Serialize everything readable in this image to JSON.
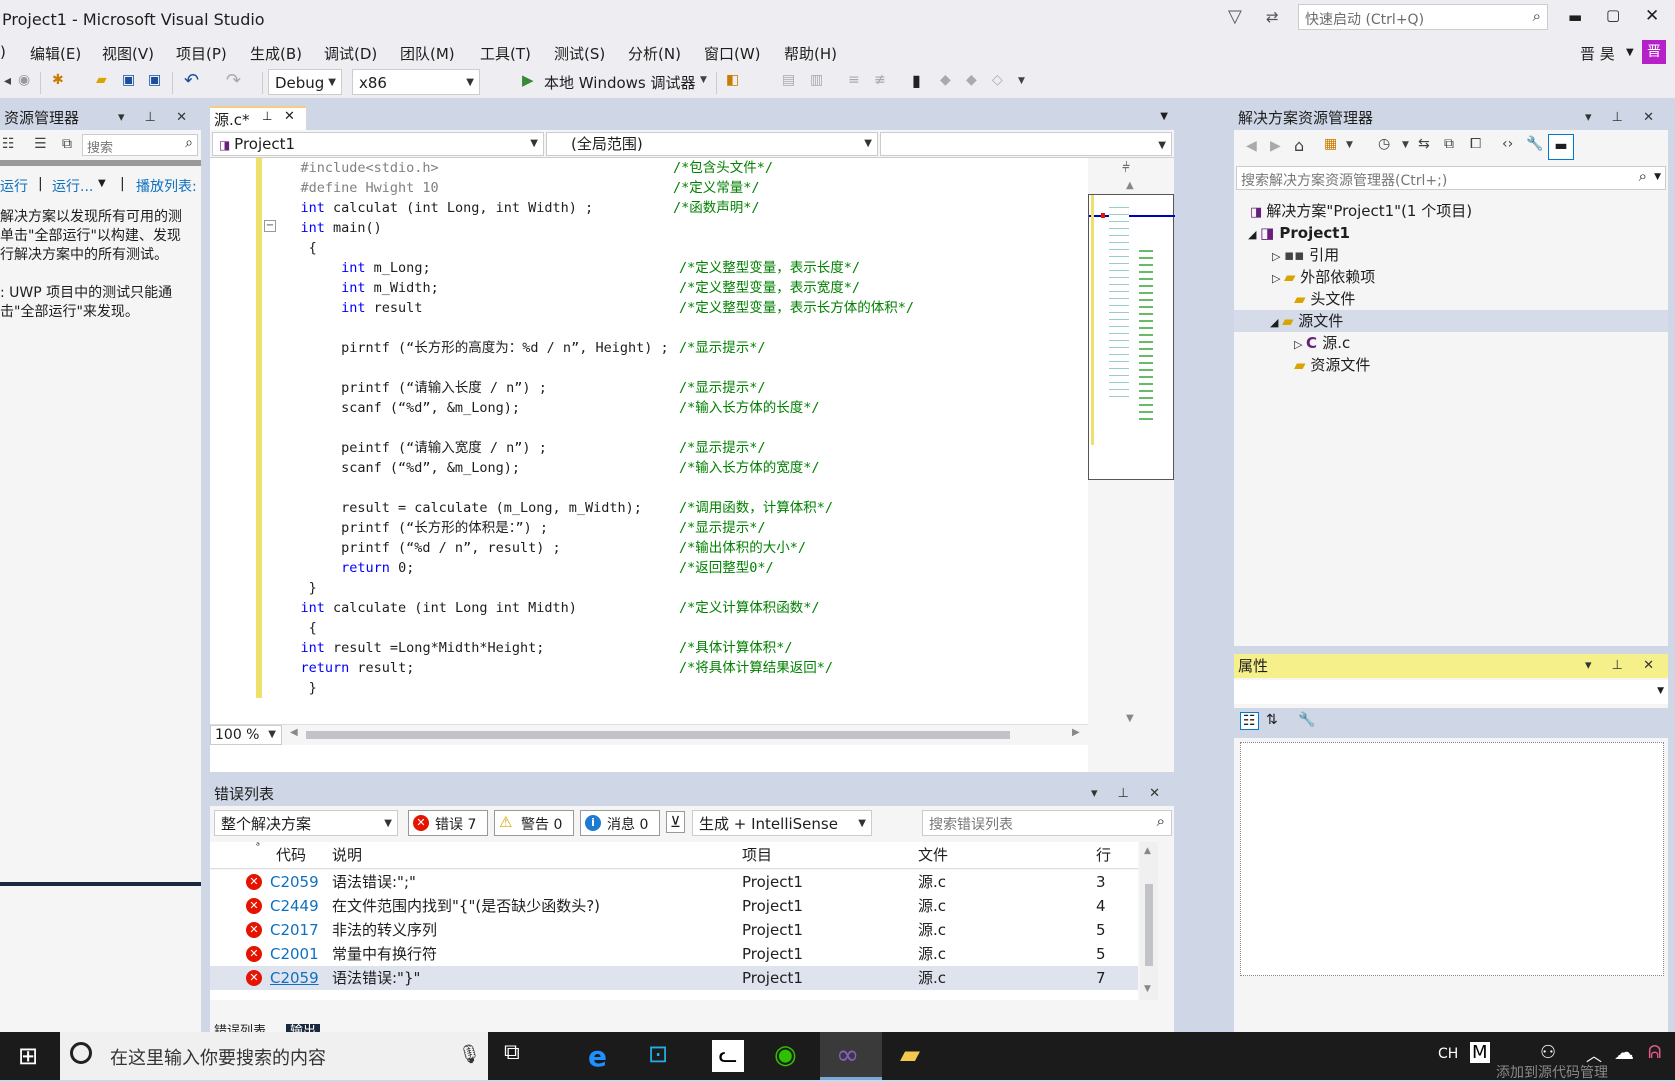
{
  "title": "Project1 - Microsoft Visual Studio",
  "quick_launch": {
    "placeholder": "快速启动 (Ctrl+Q)"
  },
  "user": {
    "name": "晋 昊",
    "initial": "晋"
  },
  "menu": [
    "编辑(E)",
    "视图(V)",
    "项目(P)",
    "生成(B)",
    "调试(D)",
    "团队(M)",
    "工具(T)",
    "测试(S)",
    "分析(N)",
    "窗口(W)",
    "帮助(H)"
  ],
  "toolbar": {
    "config": "Debug",
    "platform": "x86",
    "run_label": "本地 Windows 调试器"
  },
  "test_explorer": {
    "title": "资源管理器",
    "search_placeholder": "搜索",
    "run_label": "运行",
    "run_more_label": "运行...",
    "playlist_label": "播放列表:",
    "info_lines": [
      "解决方案以发现所有可用的测",
      "单击\"全部运行\"以构建、发现",
      "行解决方案中的所有测试。",
      "",
      ": UWP 项目中的测试只能通",
      "击\"全部运行\"来发现。"
    ]
  },
  "editor": {
    "tab_label": "源.c*",
    "nav_project": "Project1",
    "nav_scope": "(全局范围)",
    "zoom": "100 %",
    "lines": [
      {
        "code": "    #include<stdio.h>",
        "comment": "/*包含头文件*/"
      },
      {
        "code": "    #define Hwight 10",
        "comment": "/*定义常量*/"
      },
      {
        "code": "    int calculat (int Long, int Width) ;",
        "comment": "/*函数声明*/"
      },
      {
        "code": "    int main()",
        "comment": ""
      },
      {
        "code": "     {",
        "comment": ""
      },
      {
        "code": "         int m_Long;",
        "comment": "/*定义整型变量，表示长度*/"
      },
      {
        "code": "         int m_Width;",
        "comment": "/*定义整型变量，表示宽度*/"
      },
      {
        "code": "         int result",
        "comment": "/*定义整型变量，表示长方体的体积*/"
      },
      {
        "code": "",
        "comment": ""
      },
      {
        "code": "         pirntf (“长方形的高度为：%d / n”, Height) ;",
        "comment": "/*显示提示*/"
      },
      {
        "code": "",
        "comment": ""
      },
      {
        "code": "         printf (“请输入长度 / n”) ;",
        "comment": "/*显示提示*/"
      },
      {
        "code": "         scanf (“%d”, &m_Long);",
        "comment": "/*输入长方体的长度*/"
      },
      {
        "code": "",
        "comment": ""
      },
      {
        "code": "         peintf (“请输入宽度 / n”) ;",
        "comment": "/*显示提示*/"
      },
      {
        "code": "         scanf (“%d”, &m_Long);",
        "comment": "/*输入长方体的宽度*/"
      },
      {
        "code": "",
        "comment": ""
      },
      {
        "code": "         result = calculate (m_Long, m_Width);",
        "comment": "/*调用函数，计算体积*/"
      },
      {
        "code": "         printf (“长方形的体积是：”) ;",
        "comment": "/*显示提示*/"
      },
      {
        "code": "         printf (“%d / n”, result) ;",
        "comment": "/*输出体积的大小*/"
      },
      {
        "code": "         return 0;",
        "comment": "/*返回整型0*/"
      },
      {
        "code": "     }",
        "comment": ""
      },
      {
        "code": "    int calculate (int Long int Midth)",
        "comment": "/*定义计算体积函数*/"
      },
      {
        "code": "     {",
        "comment": ""
      },
      {
        "code": "    int result =Long*Midth*Height;",
        "comment": "/*具体计算体积*/"
      },
      {
        "code": "    return result;",
        "comment": "/*将具体计算结果返回*/"
      },
      {
        "code": "     }",
        "comment": ""
      }
    ]
  },
  "solution_explorer": {
    "title": "解决方案资源管理器",
    "search_placeholder": "搜索解决方案资源管理器(Ctrl+;)",
    "solution": "解决方案\"Project1\"(1 个项目)",
    "project": "Project1",
    "references": "引用",
    "external_deps": "外部依赖项",
    "headers": "头文件",
    "sources": "源文件",
    "source_file": "源.c",
    "resources": "资源文件"
  },
  "properties": {
    "title": "属性"
  },
  "error_list": {
    "title": "错误列表",
    "scope": "整个解决方案",
    "errors_label": "错误 7",
    "warnings_label": "警告 0",
    "messages_label": "消息 0",
    "source_filter": "生成 + IntelliSense",
    "search_placeholder": "搜索错误列表",
    "columns": {
      "code": "代码",
      "desc": "说明",
      "project": "项目",
      "file": "文件",
      "line": "行"
    },
    "rows": [
      {
        "code": "C2059",
        "desc": "语法错误:\";\"",
        "project": "Project1",
        "file": "源.c",
        "line": "3"
      },
      {
        "code": "C2449",
        "desc": "在文件范围内找到\"{\"(是否缺少函数头?)",
        "project": "Project1",
        "file": "源.c",
        "line": "4"
      },
      {
        "code": "C2017",
        "desc": "非法的转义序列",
        "project": "Project1",
        "file": "源.c",
        "line": "5"
      },
      {
        "code": "C2001",
        "desc": "常量中有换行符",
        "project": "Project1",
        "file": "源.c",
        "line": "5"
      },
      {
        "code": "C2059",
        "desc": "语法错误:\"}\"",
        "project": "Project1",
        "file": "源.c",
        "line": "7"
      }
    ],
    "tabs": [
      "错误列表",
      "输出"
    ]
  },
  "taskbar": {
    "search_placeholder": "在这里输入你要搜索的内容",
    "ime": "CH",
    "source_control": "添加到源代码管理"
  },
  "colors": {
    "accent": "#007acc",
    "panel_header": "#cfd6e5",
    "props_header": "#f5f08a",
    "error_red": "#e51400",
    "status_bar": "#68217a"
  }
}
